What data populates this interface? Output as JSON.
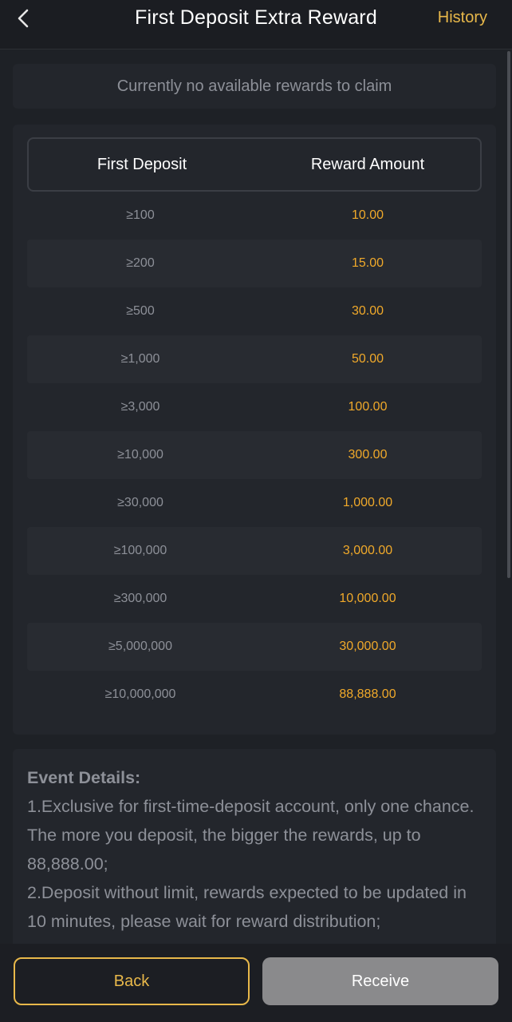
{
  "header": {
    "title": "First Deposit Extra Reward",
    "history_label": "History"
  },
  "notice": {
    "text": "Currently no available rewards to claim"
  },
  "table": {
    "col_deposit": "First Deposit",
    "col_reward": "Reward Amount",
    "rows": [
      {
        "deposit": "≥100",
        "reward": "10.00"
      },
      {
        "deposit": "≥200",
        "reward": "15.00"
      },
      {
        "deposit": "≥500",
        "reward": "30.00"
      },
      {
        "deposit": "≥1,000",
        "reward": "50.00"
      },
      {
        "deposit": "≥3,000",
        "reward": "100.00"
      },
      {
        "deposit": "≥10,000",
        "reward": "300.00"
      },
      {
        "deposit": "≥30,000",
        "reward": "1,000.00"
      },
      {
        "deposit": "≥100,000",
        "reward": "3,000.00"
      },
      {
        "deposit": "≥300,000",
        "reward": "10,000.00"
      },
      {
        "deposit": "≥5,000,000",
        "reward": "30,000.00"
      },
      {
        "deposit": "≥10,000,000",
        "reward": "88,888.00"
      }
    ]
  },
  "details": {
    "title": "Event Details:",
    "line1": "1.Exclusive for first-time-deposit account, only one chance. The more you deposit, the bigger the rewards, up to 88,888.00;",
    "line2": "2.Deposit without limit, rewards expected to be updated in 10 minutes, please wait for reward distribution;"
  },
  "footer": {
    "back_label": "Back",
    "receive_label": "Receive"
  },
  "colors": {
    "accent": "#e8b84a",
    "reward_text": "#f0a92a",
    "background": "#1e2126",
    "disabled_button": "#8a8a8c"
  },
  "icons": {
    "back": "chevron-left-icon"
  }
}
